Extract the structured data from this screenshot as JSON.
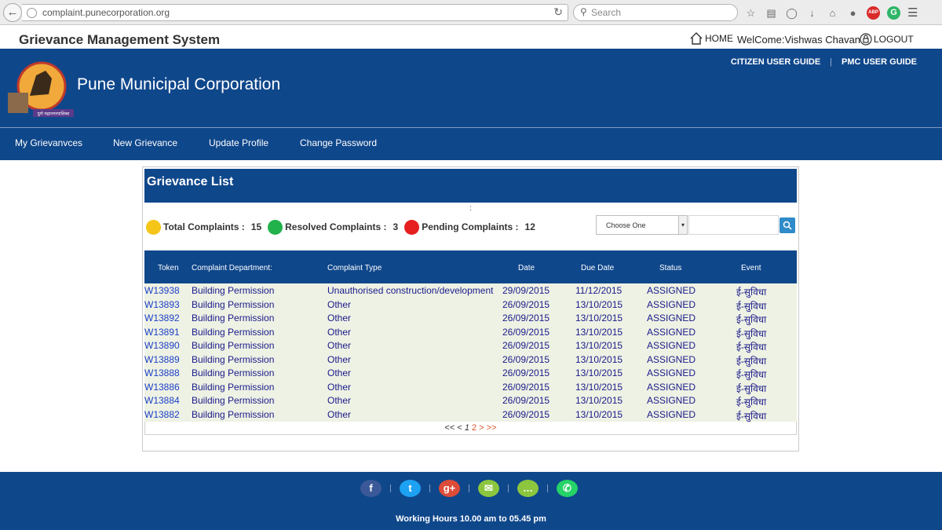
{
  "browser": {
    "url": "complaint.punecorporation.org",
    "search_placeholder": "Search"
  },
  "topbar": {
    "site_title": "Grievance Management System",
    "home_label": "HOME",
    "welcome_text": "WelCome:Vishwas Chavan",
    "logout_label": "LOGOUT"
  },
  "header": {
    "org_name": "Pune Municipal Corporation",
    "guides": [
      "CITIZEN USER GUIDE",
      "PMC USER GUIDE"
    ],
    "logo_text": "पुणे महानगरपालिका"
  },
  "nav": {
    "items": [
      "My Grievanvces",
      "New Grievance",
      "Update Profile",
      "Change Password"
    ]
  },
  "grievance": {
    "title": "Grievance List",
    "separator": ":",
    "stats": {
      "total_label": "Total Complaints :",
      "total_value": "15",
      "resolved_label": "Resolved Complaints :",
      "resolved_value": "3",
      "pending_label": "Pending Complaints :",
      "pending_value": "12",
      "colors": {
        "total": "#f5c518",
        "resolved": "#22b24c",
        "pending": "#e5201f"
      }
    },
    "filter": {
      "selected": "Choose One",
      "arrow": "▾"
    },
    "columns": [
      "Token",
      "Complaint Department:",
      "Complaint Type",
      "Date",
      "Due Date",
      "Status",
      "Event"
    ],
    "rows": [
      [
        "W13938",
        "Building Permission",
        "Unauthorised construction/development",
        "29/09/2015",
        "11/12/2015",
        "ASSIGNED",
        "ई-सुविधा"
      ],
      [
        "W13893",
        "Building Permission",
        "Other",
        "26/09/2015",
        "13/10/2015",
        "ASSIGNED",
        "ई-सुविधा"
      ],
      [
        "W13892",
        "Building Permission",
        "Other",
        "26/09/2015",
        "13/10/2015",
        "ASSIGNED",
        "ई-सुविधा"
      ],
      [
        "W13891",
        "Building Permission",
        "Other",
        "26/09/2015",
        "13/10/2015",
        "ASSIGNED",
        "ई-सुविधा"
      ],
      [
        "W13890",
        "Building Permission",
        "Other",
        "26/09/2015",
        "13/10/2015",
        "ASSIGNED",
        "ई-सुविधा"
      ],
      [
        "W13889",
        "Building Permission",
        "Other",
        "26/09/2015",
        "13/10/2015",
        "ASSIGNED",
        "ई-सुविधा"
      ],
      [
        "W13888",
        "Building Permission",
        "Other",
        "26/09/2015",
        "13/10/2015",
        "ASSIGNED",
        "ई-सुविधा"
      ],
      [
        "W13886",
        "Building Permission",
        "Other",
        "26/09/2015",
        "13/10/2015",
        "ASSIGNED",
        "ई-सुविधा"
      ],
      [
        "W13884",
        "Building Permission",
        "Other",
        "26/09/2015",
        "13/10/2015",
        "ASSIGNED",
        "ई-सुविधा"
      ],
      [
        "W13882",
        "Building Permission",
        "Other",
        "26/09/2015",
        "13/10/2015",
        "ASSIGNED",
        "ई-सुविधा"
      ]
    ],
    "pager": {
      "first": "<<",
      "prev": "<",
      "page1": "1",
      "page2": "2",
      "next": ">",
      "last": ">>"
    }
  },
  "footer": {
    "social": [
      {
        "name": "facebook",
        "glyph": "f",
        "color": "#3b5998"
      },
      {
        "name": "twitter",
        "glyph": "t",
        "color": "#1da1f2"
      },
      {
        "name": "google-plus",
        "glyph": "g+",
        "color": "#dd4b39"
      },
      {
        "name": "email",
        "glyph": "✉",
        "color": "#8cc63f"
      },
      {
        "name": "sms",
        "glyph": "…",
        "color": "#8cc63f"
      },
      {
        "name": "whatsapp",
        "glyph": "✆",
        "color": "#25d366"
      }
    ],
    "working_hours": "Working Hours 10.00 am to 05.45 pm"
  }
}
